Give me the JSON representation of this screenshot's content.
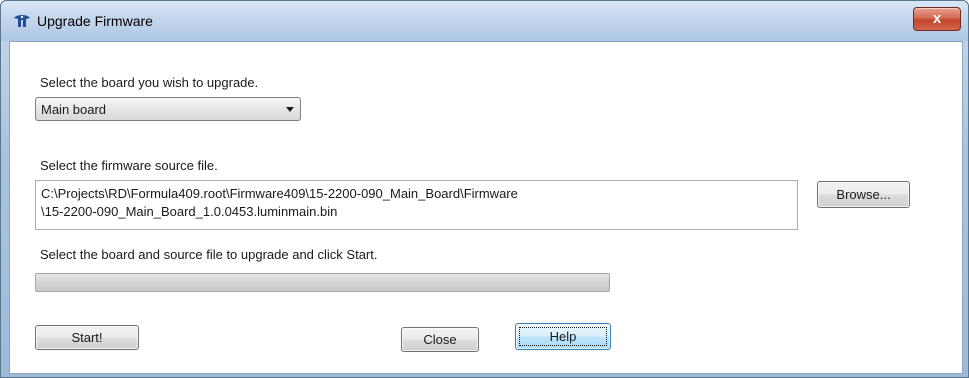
{
  "window": {
    "title": "Upgrade Firmware",
    "close_glyph": "x",
    "icon": "app-logo-icon"
  },
  "board": {
    "prompt": "Select the board you wish to upgrade.",
    "selected": "Main board"
  },
  "firmware": {
    "prompt": "Select the firmware source file.",
    "path_line1": "C:\\Projects\\RD\\Formula409.root\\Firmware409\\15-2200-090_Main_Board\\Firmware",
    "path_line2": "\\15-2200-090_Main_Board_1.0.0453.luminmain.bin",
    "browse_label": "Browse..."
  },
  "status": {
    "message": "Select the board and source file to upgrade and click Start.",
    "progress_percent": 0
  },
  "buttons": {
    "start_label": "Start!",
    "close_label": "Close",
    "help_label": "Help"
  },
  "colors": {
    "titlebar": "#c3d6ec",
    "close_button": "#c2442c",
    "help_focus_border": "#3c7fb1"
  }
}
